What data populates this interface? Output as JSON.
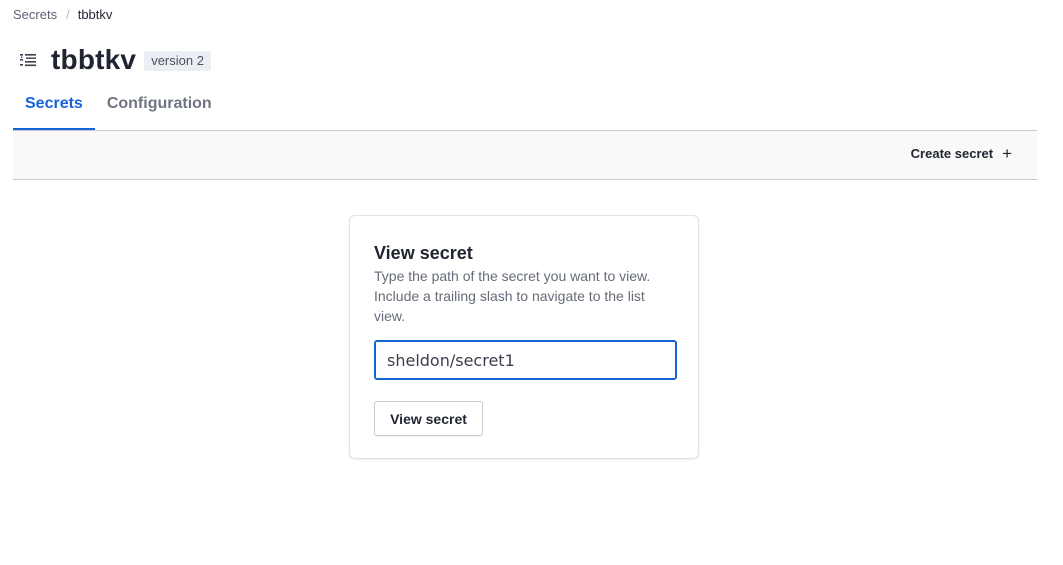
{
  "breadcrumb": {
    "root": "Secrets",
    "separator": "/",
    "current": "tbbtkv"
  },
  "header": {
    "icon": "kv-list-icon",
    "title": "tbbtkv",
    "version_badge": "version 2"
  },
  "tabs": [
    {
      "label": "Secrets",
      "active": true
    },
    {
      "label": "Configuration",
      "active": false
    }
  ],
  "toolbar": {
    "create_label": "Create secret",
    "create_icon": "+"
  },
  "view_card": {
    "title": "View secret",
    "description": "Type the path of the secret you want to view. Include a trailing slash to navigate to the list view.",
    "input_value": "sheldon/secret1",
    "button_label": "View secret"
  },
  "colors": {
    "accent": "#1563d6",
    "toolbar_bg": "#f9f9fa",
    "badge_bg": "#ebeef2"
  }
}
